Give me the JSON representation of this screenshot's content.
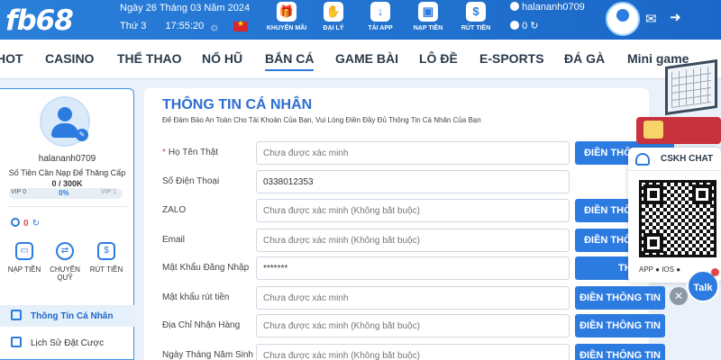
{
  "header": {
    "logo": "fb68",
    "date": "Ngày 26 Tháng 03 Năm 2024",
    "weekday": "Thứ 3",
    "time": "17:55:20",
    "buttons": [
      {
        "label": "KHUYẾN MÃI",
        "icon": "gift-icon"
      },
      {
        "label": "ĐẠI LÝ",
        "icon": "handshake-icon"
      },
      {
        "label": "TẢI APP",
        "icon": "download-app-icon"
      },
      {
        "label": "NẠP TIỀN",
        "icon": "wallet-icon"
      },
      {
        "label": "RÚT TIỀN",
        "icon": "money-bag-icon"
      }
    ],
    "username": "halananh0709",
    "balance": "0"
  },
  "nav": [
    "HOT",
    "CASINO",
    "THỂ THAO",
    "NỔ HŨ",
    "BẮN CÁ",
    "GAME BÀI",
    "LÔ ĐỀ",
    "E-SPORTS",
    "ĐÁ GÀ",
    "Mini game"
  ],
  "nav_active": "BẮN CÁ",
  "sidebar": {
    "username": "halananh0709",
    "deposit_label": "Số Tiền Cần Nạp Để Thăng Cấp",
    "progress_text": "0 / 300K",
    "progress_percent": 0,
    "vip_current": "VIP 0",
    "vip_percent_label": "0%",
    "vip_next": "VIP 1",
    "balance": "0",
    "actions": [
      "NẠP TIỀN",
      "CHUYỂN QUỸ",
      "RÚT TIỀN"
    ],
    "menu": [
      "Thông Tin Cá Nhân",
      "Lịch Sử Đặt Cược"
    ]
  },
  "form": {
    "title": "THÔNG TIN CÁ NHÂN",
    "subtitle": "Để Đảm Bảo An Toàn Cho Tài Khoản Của Bạn, Vui Lòng Điền Đầy Đủ Thông Tin Cá Nhân Của Bạn",
    "rows": [
      {
        "label": "Họ Tên Thật",
        "required": "*",
        "placeholder": "Chưa được xác minh",
        "value": "",
        "button": "ĐIỀN THÔNG TIN"
      },
      {
        "label": "Số Điện Thoại",
        "placeholder": "",
        "value": "0338012353",
        "button": ""
      },
      {
        "label": "ZALO",
        "placeholder": "Chưa được xác minh (Không bắt buộc)",
        "value": "",
        "button": "ĐIỀN THÔNG TIN"
      },
      {
        "label": "Email",
        "placeholder": "Chưa được xác minh (Không bắt buộc)",
        "value": "",
        "button": "ĐIỀN THÔNG TIN"
      },
      {
        "label": "Mật Khẩu Đăng Nhập",
        "placeholder": "",
        "value": "*******",
        "button": "THAY ĐỔI"
      },
      {
        "label": "Mật khẩu rút tiền",
        "placeholder": "Chưa được xác minh",
        "value": "",
        "button": "ĐIỀN THÔNG TIN"
      },
      {
        "label": "Địa Chỉ Nhận Hàng",
        "placeholder": "Chưa được xác minh (Không bắt buộc)",
        "value": "",
        "button": "ĐIỀN THÔNG TIN"
      },
      {
        "label": "Ngày Tháng Năm Sinh",
        "placeholder": "Chưa được xác minh (Không bắt buộc)",
        "value": "",
        "button": "ĐIỀN THÔNG TIN"
      }
    ]
  },
  "support": {
    "title": "CSKH CHAT",
    "app_label": "APP",
    "ios_label": "IOS",
    "talk_label": "Talk"
  },
  "colors": {
    "brand": "#2c7be0",
    "header_bg": "#2a7fd9",
    "alert": "#e14848"
  }
}
